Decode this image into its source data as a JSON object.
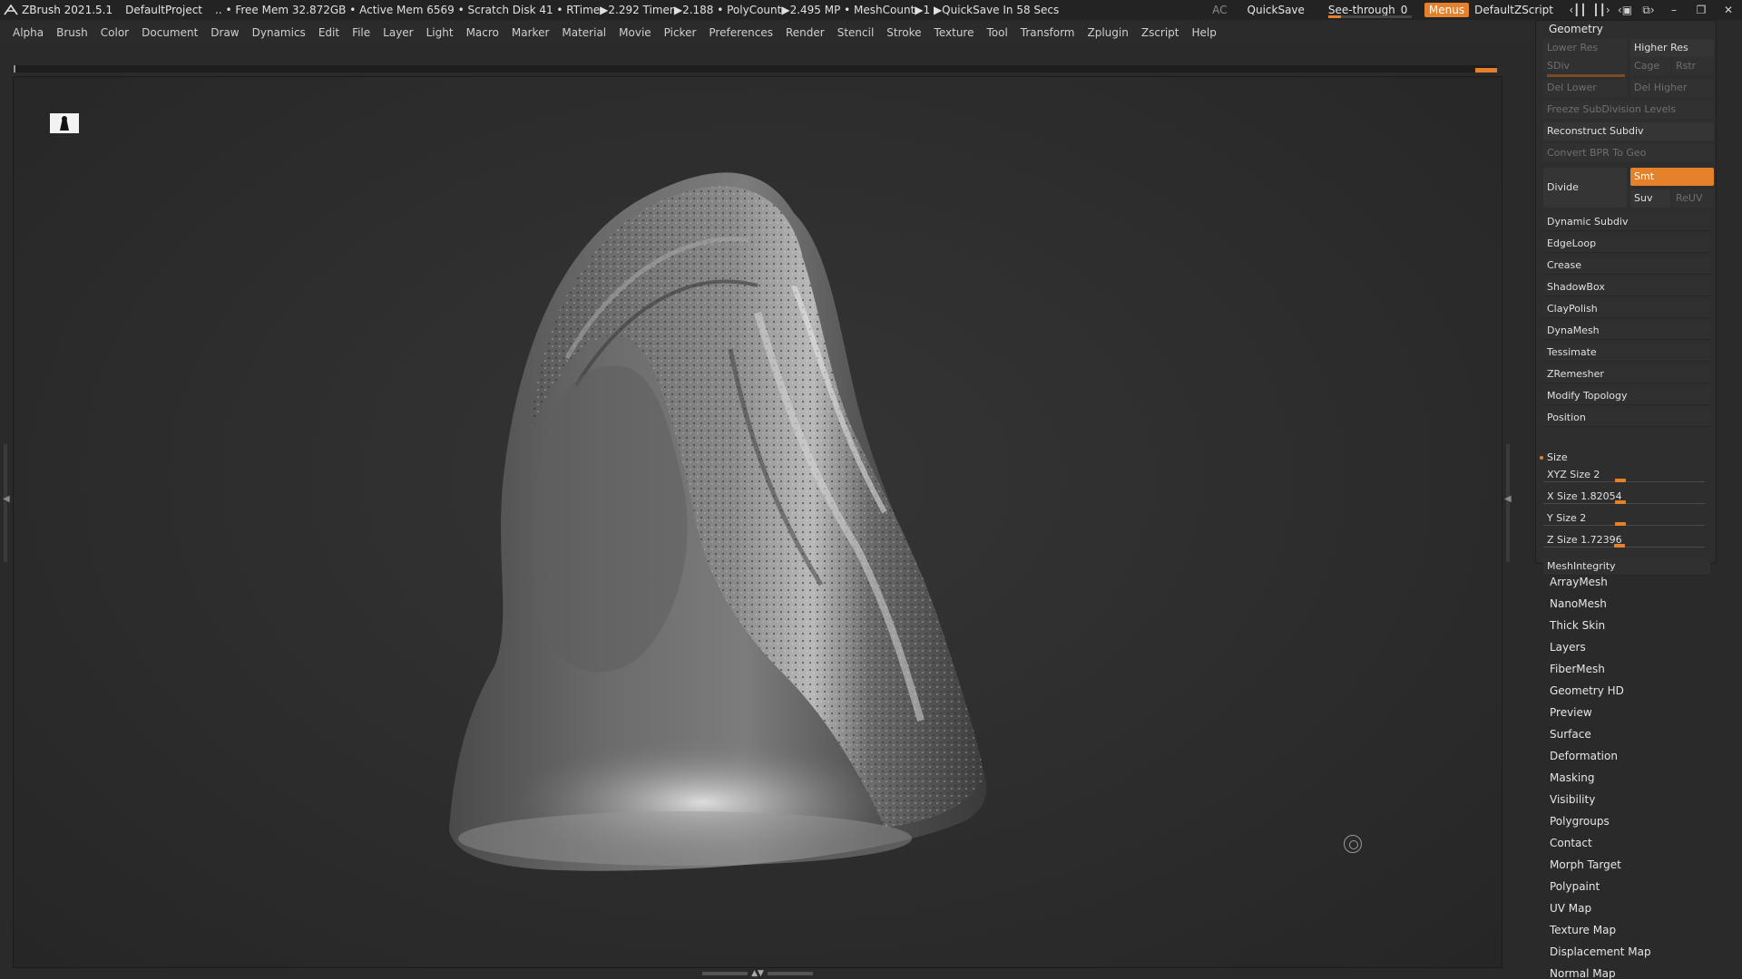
{
  "titlebar": {
    "app": "ZBrush 2021.5.1",
    "project": "DefaultProject",
    "stats": "..  • Free Mem 32.872GB • Active Mem 6569 • Scratch Disk 41 •  RTime▶2.292 Timer▶2.188 • PolyCount▶2.495 MP  • MeshCount▶1  ▶QuickSave In 58 Secs",
    "ac": "AC",
    "quicksave": "QuickSave",
    "seethrough": "See-through",
    "seethrough_value": "0",
    "seethrough_level": 0.0,
    "menus": "Menus",
    "script": "DefaultZScript",
    "icons": [
      "layout-left-icon",
      "layout-right-icon",
      "rotate-icon",
      "copy-window-icon",
      "minimize-icon",
      "restore-icon",
      "close-icon"
    ],
    "accent": "#e5802b"
  },
  "menubar": [
    "Alpha",
    "Brush",
    "Color",
    "Document",
    "Draw",
    "Dynamics",
    "Edit",
    "File",
    "Layer",
    "Light",
    "Macro",
    "Marker",
    "Material",
    "Movie",
    "Picker",
    "Preferences",
    "Render",
    "Stencil",
    "Stroke",
    "Texture",
    "Tool",
    "Transform",
    "Zplugin",
    "Zscript",
    "Help"
  ],
  "geometry": {
    "title": "Geometry",
    "lower_res": "Lower Res",
    "higher_res": "Higher Res",
    "sdiv": "SDiv",
    "cage": "Cage",
    "rstr": "Rstr",
    "del_lower": "Del Lower",
    "del_higher": "Del Higher",
    "freeze": "Freeze SubDivision Levels",
    "reconstruct": "Reconstruct Subdiv",
    "convert_bpr": "Convert BPR To Geo",
    "divide": "Divide",
    "smt": "Smt",
    "suv": "Suv",
    "reuv": "ReUV",
    "subpalettes": [
      "Dynamic Subdiv",
      "EdgeLoop",
      "Crease",
      "ShadowBox",
      "ClayPolish",
      "DynaMesh",
      "Tessimate",
      "ZRemesher",
      "Modify Topology",
      "Position"
    ],
    "size_title": "Size",
    "sliders": [
      {
        "label": "XYZ Size",
        "value": "2",
        "level": 0.48
      },
      {
        "label": "X Size",
        "value": "1.82054",
        "level": 0.48
      },
      {
        "label": "Y Size",
        "value": "2",
        "level": 0.48
      },
      {
        "label": "Z Size",
        "value": "1.72396",
        "level": 0.47
      }
    ],
    "meshintegrity": "MeshIntegrity"
  },
  "tool_palettes": [
    "ArrayMesh",
    "NanoMesh",
    "Thick Skin",
    "Layers",
    "FiberMesh",
    "Geometry HD",
    "Preview",
    "Surface",
    "Deformation",
    "Masking",
    "Visibility",
    "Polygroups",
    "Contact",
    "Morph Target",
    "Polypaint",
    "UV Map",
    "Texture Map",
    "Displacement Map",
    "Normal Map"
  ]
}
